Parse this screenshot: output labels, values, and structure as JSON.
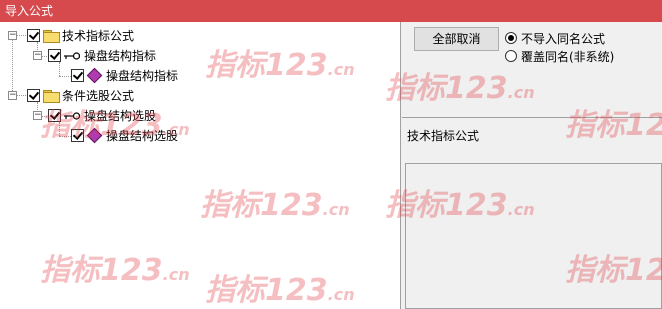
{
  "window": {
    "title": "导入公式"
  },
  "tree": {
    "items": [
      {
        "label": "技术指标公式",
        "icon": "folder-icon",
        "checked": true
      },
      {
        "label": "操盘结构指标",
        "icon": "key-icon",
        "checked": true
      },
      {
        "label": "操盘结构指标",
        "icon": "formula-diamond-icon",
        "checked": true
      },
      {
        "label": "条件选股公式",
        "icon": "folder-icon",
        "checked": true
      },
      {
        "label": "操盘结构选股",
        "icon": "key-icon",
        "checked": true
      },
      {
        "label": "操盘结构选股",
        "icon": "formula-diamond-icon",
        "checked": true
      }
    ]
  },
  "right": {
    "button_label": "全部取消",
    "radio_options": [
      {
        "label": "不导入同名公式",
        "selected": true
      },
      {
        "label": "覆盖同名(非系统)",
        "selected": false
      }
    ],
    "info_text": "技术指标公式"
  },
  "watermark": {
    "text_main": "指标123",
    "text_suffix": ".cn",
    "color": "#e13c46"
  }
}
